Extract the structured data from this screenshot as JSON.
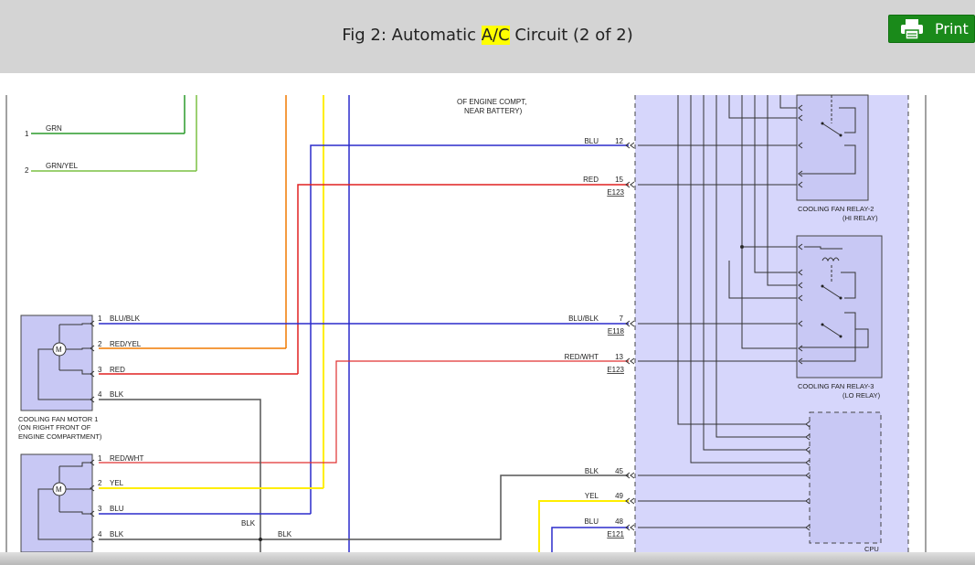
{
  "header": {
    "title_pre": "Fig 2: Automatic ",
    "title_hl": "A/C",
    "title_post": " Circuit (2 of 2)",
    "print_label": "Print"
  },
  "colors": {
    "grn": "#2a9a2a",
    "grn_yel": "#7ac142",
    "blu": "#2b2bcc",
    "red": "#e02020",
    "red_yel": "#f07a00",
    "yel": "#ffee00",
    "blk": "#555555",
    "red_wht": "#e03030",
    "panel": "#d6d6fb",
    "relay": "#c8c8f4"
  },
  "diagram": {
    "note_line1": "OF ENGINE COMPT,",
    "note_line2": "NEAR BATTERY)",
    "left_pins": [
      {
        "num": "1",
        "label": "GRN"
      },
      {
        "num": "2",
        "label": "GRN/YEL"
      }
    ],
    "motor1": {
      "name_line1": "COOLING FAN MOTOR 1",
      "name_line2": "(ON RIGHT FRONT OF",
      "name_line3": "ENGINE COMPARTMENT)",
      "pins": [
        {
          "num": "1",
          "label": "BLU/BLK"
        },
        {
          "num": "2",
          "label": "RED/YEL"
        },
        {
          "num": "3",
          "label": "RED"
        },
        {
          "num": "4",
          "label": "BLK"
        }
      ]
    },
    "motor2": {
      "pins": [
        {
          "num": "1",
          "label": "RED/WHT"
        },
        {
          "num": "2",
          "label": "YEL"
        },
        {
          "num": "3",
          "label": "BLU"
        },
        {
          "num": "4",
          "label": "BLK"
        }
      ]
    },
    "ground_label_1": "BLK",
    "ground_label_2": "BLK",
    "right_pins": [
      {
        "label": "BLU",
        "num": "12",
        "conn": ""
      },
      {
        "label": "RED",
        "num": "15",
        "conn": "E123"
      },
      {
        "label": "BLU/BLK",
        "num": "7",
        "conn": "E118"
      },
      {
        "label": "RED/WHT",
        "num": "13",
        "conn": "E123"
      },
      {
        "label": "BLK",
        "num": "45",
        "conn": ""
      },
      {
        "label": "YEL",
        "num": "49",
        "conn": ""
      },
      {
        "label": "BLU",
        "num": "48",
        "conn": "E121"
      }
    ],
    "relay2_line1": "COOLING FAN RELAY-2",
    "relay2_line2": "(HI RELAY)",
    "relay3_line1": "COOLING FAN RELAY-3",
    "relay3_line2": "(LO RELAY)",
    "cpu_label": "CPU",
    "motor_symbol": "M"
  }
}
